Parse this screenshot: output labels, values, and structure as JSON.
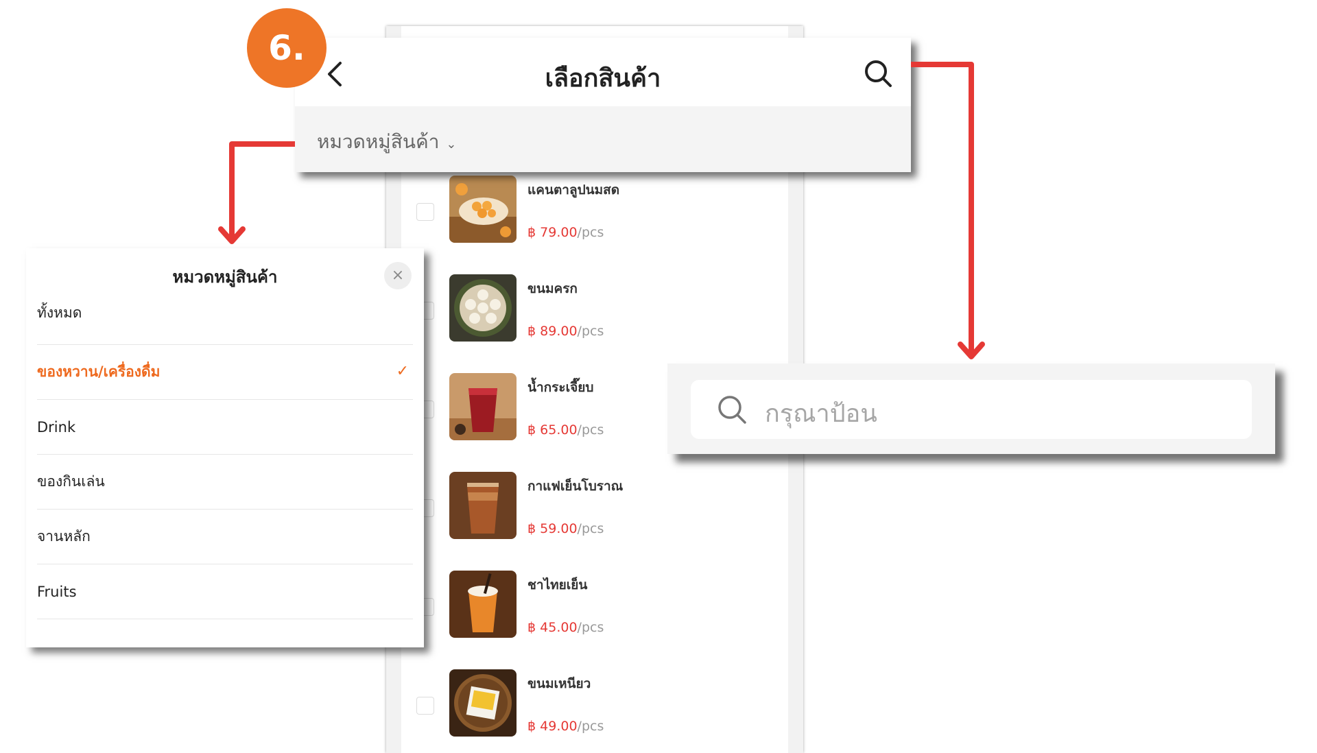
{
  "badge": {
    "text": "6."
  },
  "header": {
    "title": "เลือกสินค้า",
    "category_filter_label": "หมวดหมู่สินค้า"
  },
  "products": [
    {
      "name": "แคนตาลูปนมสด",
      "currency": "฿",
      "price": "79.00",
      "unit": "/pcs",
      "image": "cantaloupe-milk-dessert"
    },
    {
      "name": "ขนมครก",
      "currency": "฿",
      "price": "89.00",
      "unit": "/pcs",
      "image": "khanom-krok"
    },
    {
      "name": "น้ำกระเจี๊ยบ",
      "currency": "฿",
      "price": "65.00",
      "unit": "/pcs",
      "image": "roselle-drink"
    },
    {
      "name": "กาแฟเย็นโบราณ",
      "currency": "฿",
      "price": "59.00",
      "unit": "/pcs",
      "image": "iced-coffee"
    },
    {
      "name": "ชาไทยเย็น",
      "currency": "฿",
      "price": "45.00",
      "unit": "/pcs",
      "image": "thai-iced-tea"
    },
    {
      "name": "ขนมเหนียว",
      "currency": "฿",
      "price": "49.00",
      "unit": "/pcs",
      "image": "sticky-rice-dessert"
    }
  ],
  "category_sheet": {
    "title": "หมวดหมู่สินค้า",
    "close_icon": "close-icon",
    "items": [
      {
        "label": "ทั้งหมด",
        "selected": false
      },
      {
        "label": "ของหวาน/เครื่องดื่ม",
        "selected": true
      },
      {
        "label": "Drink",
        "selected": false
      },
      {
        "label": "ของกินเล่น",
        "selected": false
      },
      {
        "label": "จานหลัก",
        "selected": false
      },
      {
        "label": "Fruits",
        "selected": false
      }
    ]
  },
  "search": {
    "placeholder": "กรุณาป้อน"
  },
  "colors": {
    "accent": "#ee7527",
    "price": "#e53935",
    "arrow": "#e53935",
    "selected": "#ee6a1f"
  }
}
